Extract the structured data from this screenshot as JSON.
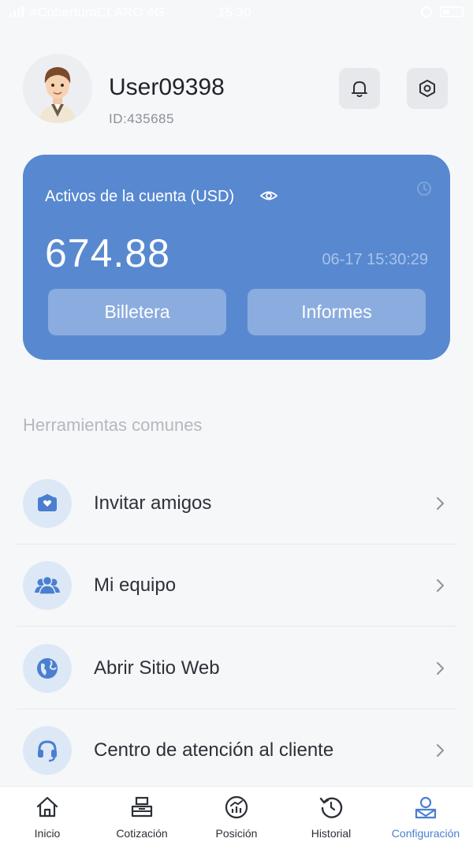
{
  "status_bar": {
    "carrier": "#CoberturaCLARO  4G",
    "time": "15:30"
  },
  "profile": {
    "username": "User09398",
    "id": "ID:435685"
  },
  "assets_card": {
    "label": "Activos de la cuenta (USD)",
    "balance": "674.88",
    "timestamp": "06-17 15:30:29",
    "wallet_label": "Billetera",
    "reports_label": "Informes",
    "accent_color": "#5889d0"
  },
  "tools": {
    "title": "Herramientas comunes",
    "items": [
      {
        "label": "Invitar amigos",
        "icon": "invite-icon"
      },
      {
        "label": "Mi equipo",
        "icon": "team-icon"
      },
      {
        "label": "Abrir Sitio Web",
        "icon": "globe-icon"
      },
      {
        "label": "Centro de atención al cliente",
        "icon": "headset-icon"
      }
    ]
  },
  "bottom_nav": {
    "active_color": "#4a7fd0",
    "items": [
      {
        "label": "Inicio",
        "icon": "home-icon"
      },
      {
        "label": "Cotización",
        "icon": "quotes-icon"
      },
      {
        "label": "Posición",
        "icon": "position-icon"
      },
      {
        "label": "Historial",
        "icon": "history-icon"
      },
      {
        "label": "Configuración",
        "icon": "profile-icon",
        "active": true
      }
    ]
  }
}
